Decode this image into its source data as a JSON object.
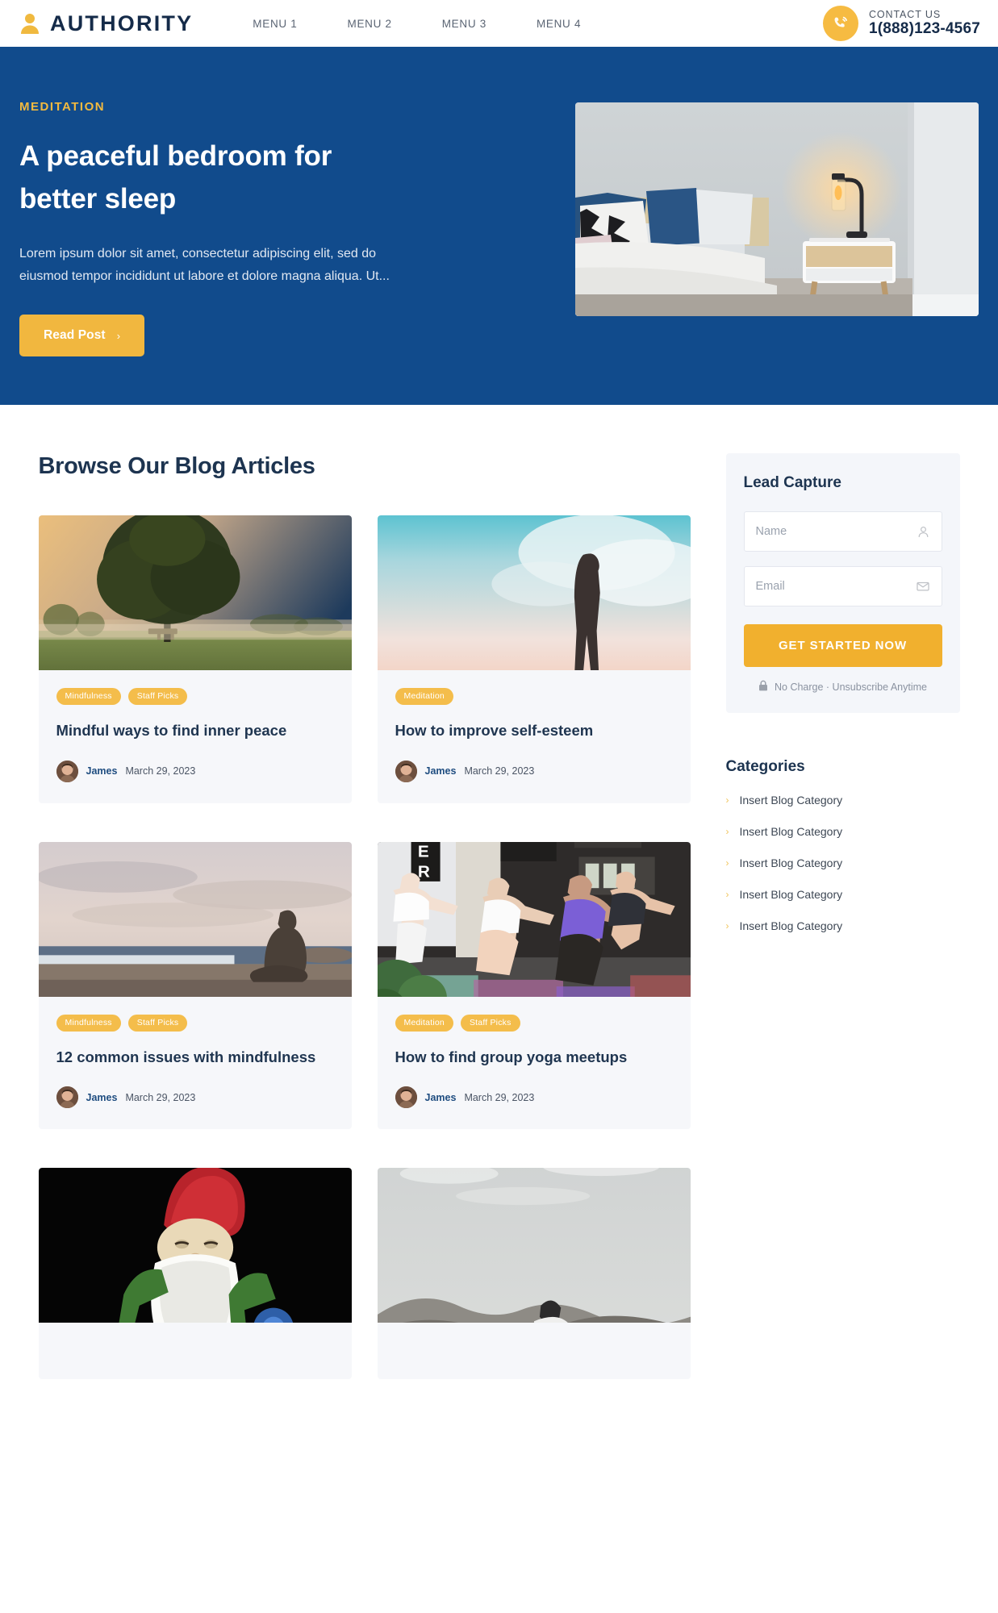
{
  "header": {
    "logo_icon": "person-icon",
    "brand": "AUTHORITY",
    "nav": [
      {
        "label": "MENU 1"
      },
      {
        "label": "MENU 2"
      },
      {
        "label": "MENU 3"
      },
      {
        "label": "MENU 4"
      }
    ],
    "contact": {
      "icon": "phone-icon",
      "label": "CONTACT US",
      "phone": "1(888)123-4567"
    }
  },
  "hero": {
    "eyebrow": "MEDITATION",
    "title": "A peaceful bedroom for better sleep",
    "description": "Lorem ipsum dolor sit amet, consectetur adipiscing elit, sed do eiusmod tempor incididunt ut labore et dolore magna aliqua. Ut...",
    "button_label": "Read Post",
    "button_chevron": "›",
    "image_alt": "bedroom-photo"
  },
  "main": {
    "section_title": "Browse Our Blog Articles",
    "cards": [
      {
        "image": "tree-at-sunrise",
        "tags": [
          "Mindfulness",
          "Staff Picks"
        ],
        "title": "Mindful ways to find inner peace",
        "author": "James",
        "date": "March 29, 2023"
      },
      {
        "image": "person-on-horizon",
        "tags": [
          "Meditation"
        ],
        "title": "How to improve self-esteem",
        "author": "James",
        "date": "March 29, 2023"
      },
      {
        "image": "beach-meditation",
        "tags": [
          "Mindfulness",
          "Staff Picks"
        ],
        "title": "12 common issues with mindfulness",
        "author": "James",
        "date": "March 29, 2023"
      },
      {
        "image": "group-yoga-class",
        "tags": [
          "Meditation",
          "Staff Picks"
        ],
        "title": "How to find group yoga meetups",
        "author": "James",
        "date": "March 29, 2023"
      },
      {
        "image": "meditating-gnome",
        "tags": [],
        "title": "",
        "author": "",
        "date": ""
      },
      {
        "image": "mountain-overlook",
        "tags": [],
        "title": "",
        "author": "",
        "date": ""
      }
    ]
  },
  "sidebar": {
    "lead": {
      "title": "Lead Capture",
      "name_value": "",
      "name_placeholder": "Name",
      "name_icon": "user-icon",
      "email_value": "",
      "email_placeholder": "Email",
      "email_icon": "envelope-icon",
      "cta_label": "GET STARTED NOW",
      "disclaimer_icon": "lock-icon",
      "disclaimer": "No Charge · Unsubscribe Anytime"
    },
    "categories": {
      "title": "Categories",
      "chevron": "›",
      "items": [
        {
          "label": "Insert Blog Category"
        },
        {
          "label": "Insert Blog Category"
        },
        {
          "label": "Insert Blog Category"
        },
        {
          "label": "Insert Blog Category"
        },
        {
          "label": "Insert Blog Category"
        }
      ]
    }
  },
  "colors": {
    "brand_blue": "#114b8c",
    "accent_yellow": "#f1b73f",
    "navy_text": "#1d3450",
    "card_bg": "#f6f7fa"
  }
}
